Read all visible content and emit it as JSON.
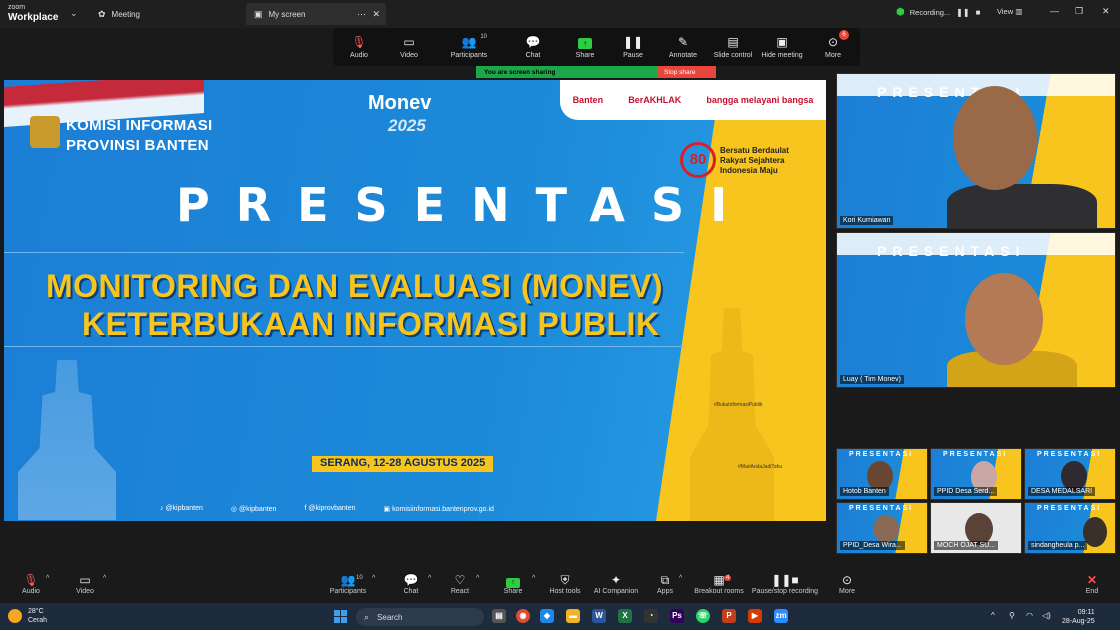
{
  "app": {
    "logo_top": "zoom",
    "logo_bottom": "Workplace"
  },
  "tabs": {
    "meeting": "Meeting",
    "screen": "My screen"
  },
  "status": {
    "recording": "Recording...",
    "view": "View"
  },
  "toolbar": {
    "audio": "Audio",
    "video": "Video",
    "participants": "Participants",
    "participants_count": "10",
    "chat": "Chat",
    "share": "Share",
    "pause": "Pause",
    "annotate": "Annotate",
    "slide_control": "Slide control",
    "hide_meeting": "Hide meeting",
    "more": "More",
    "more_badge": "6"
  },
  "sharebar": {
    "sharing": "You are screen sharing",
    "stop": "Stop share"
  },
  "slide": {
    "org": [
      "KOMISI INFORMASI",
      "PROVINSI BANTEN"
    ],
    "monev": "Monev",
    "year": "2025",
    "sponsors": [
      "Banten",
      "BerAKHLAK",
      "bangga melayani bangsa"
    ],
    "badge80": "80",
    "badge80_text": "Bersatu Berdaulat Rakyat Sejahtera Indonesia Maju",
    "title": "PRESENTASI",
    "heading1": "MONITORING DAN EVALUASI (MONEV)",
    "heading2": "KETERBUKAAN INFORMASI PUBLIK",
    "date": "SERANG, 12-28 AGUSTUS 2025",
    "tag1": "#BukaInformasiPublik",
    "tag2": "#MariAndaJadiTahu",
    "socials": [
      "@kipbanten",
      "@kipbanten",
      "@kiprovbanten",
      "komisiinformasi.bantenprov.go.id"
    ]
  },
  "participants_big": [
    {
      "name": "Kori Kurniawan"
    },
    {
      "name": "Luay ( Tim Monev)"
    }
  ],
  "participants_small": [
    {
      "name": "Hotob Banten"
    },
    {
      "name": "PPID Desa Serd..."
    },
    {
      "name": "DESA MEDALSARI"
    },
    {
      "name": "PPID_Desa Wira..."
    },
    {
      "name": "MOCH OJAT SU..."
    },
    {
      "name": "sindangheula p..."
    }
  ],
  "bottombar": {
    "audio": "Audio",
    "video": "Video",
    "participants": "Participants",
    "participants_count": "10",
    "chat": "Chat",
    "react": "React",
    "share": "Share",
    "host_tools": "Host tools",
    "ai": "AI Companion",
    "apps": "Apps",
    "breakout": "Breakout rooms",
    "breakout_badge": "4",
    "pause_rec": "Pause/stop recording",
    "more": "More",
    "end": "End"
  },
  "taskbar": {
    "temp": "28°C",
    "weather": "Cerah",
    "search": "Search",
    "time": "09:11",
    "date": "28-Aug-25"
  }
}
